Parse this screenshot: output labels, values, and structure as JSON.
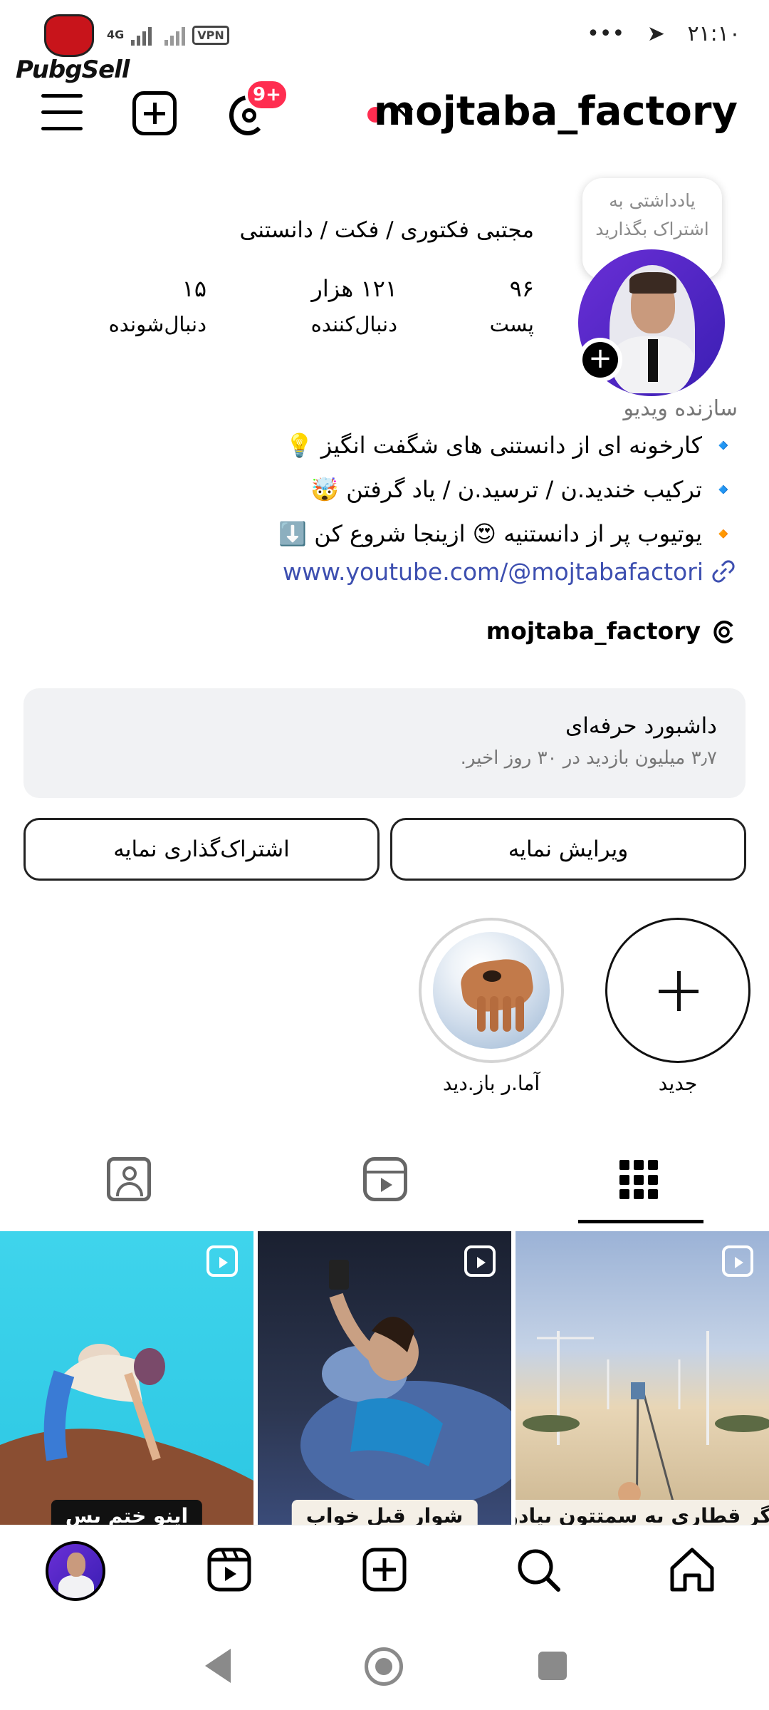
{
  "status_bar": {
    "time": "۲۱:۱۰",
    "network": "4G",
    "vpn": "VPN",
    "dots": "•••",
    "watermark_text": "PubgSell"
  },
  "header": {
    "username": "mojtaba_factory",
    "notification_badge": "9+"
  },
  "profile": {
    "note": "یادداشتی به اشتراک بگذارید",
    "full_name": "مجتبی فکتوری / فکت / دانستنی",
    "stats": {
      "posts_count": "۹۶",
      "posts_label": "پست",
      "followers_count": "۱۲۱ هزار",
      "followers_label": "دنبال‌کننده",
      "following_count": "۱۵",
      "following_label": "دنبال‌شونده"
    },
    "category": "سازنده ویدیو",
    "bio": [
      "🔹 کارخونه ای از دانستنی های شگفت انگیز 💡",
      "🔹 ترکیب خندید.ن / ترسید.ن / یاد گرفتن 🤯",
      "🔸 یوتیوب پر از دانستنیه 😍 ازینجا شروع کن ⬇️"
    ],
    "link": "www.youtube.com/@mojtabafactori",
    "threads_handle": "mojtaba_factory"
  },
  "dashboard": {
    "title": "داشبورد حرفه‌ای",
    "subtitle": "۳٫۷ میلیون بازدید در ۳۰ روز اخیر."
  },
  "buttons": {
    "edit_profile": "ویرایش نمایه",
    "share_profile": "اشتراک‌گذاری نمایه"
  },
  "highlights": {
    "new_label": "جدید",
    "story_label": "آما.ر باز.دید"
  },
  "posts": [
    {
      "caption": "اگر قطاری به سمتتون بیادو"
    },
    {
      "caption": "شوار قبل خواب"
    },
    {
      "caption": "اینو ختم بس"
    }
  ]
}
